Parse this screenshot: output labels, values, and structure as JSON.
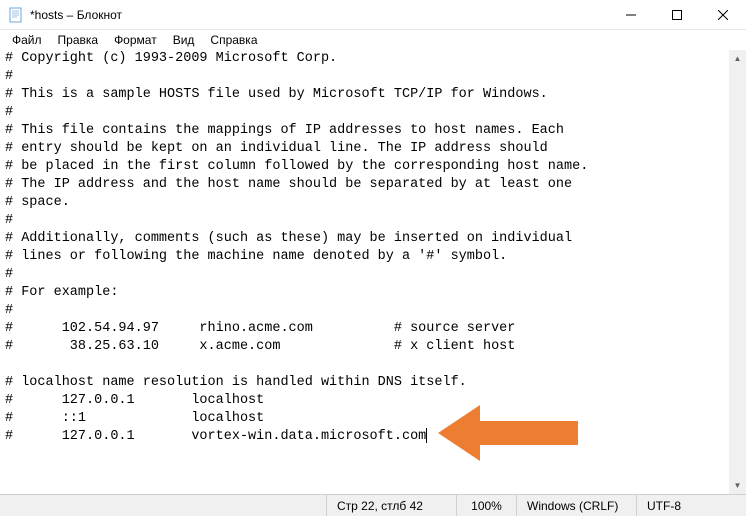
{
  "window": {
    "title": "*hosts – Блокнот"
  },
  "menu": {
    "file": "Файл",
    "edit": "Правка",
    "format": "Формат",
    "view": "Вид",
    "help": "Справка"
  },
  "content": {
    "text": "# Copyright (c) 1993-2009 Microsoft Corp.\n#\n# This is a sample HOSTS file used by Microsoft TCP/IP for Windows.\n#\n# This file contains the mappings of IP addresses to host names. Each\n# entry should be kept on an individual line. The IP address should\n# be placed in the first column followed by the corresponding host name.\n# The IP address and the host name should be separated by at least one\n# space.\n#\n# Additionally, comments (such as these) may be inserted on individual\n# lines or following the machine name denoted by a '#' symbol.\n#\n# For example:\n#\n#      102.54.94.97     rhino.acme.com          # source server\n#       38.25.63.10     x.acme.com              # x client host\n\n# localhost name resolution is handled within DNS itself.\n#      127.0.0.1       localhost\n#      ::1             localhost\n#      127.0.0.1       vortex-win.data.microsoft.com"
  },
  "status": {
    "position": "Стр 22, стлб 42",
    "zoom": "100%",
    "line_ending": "Windows (CRLF)",
    "encoding": "UTF-8"
  }
}
